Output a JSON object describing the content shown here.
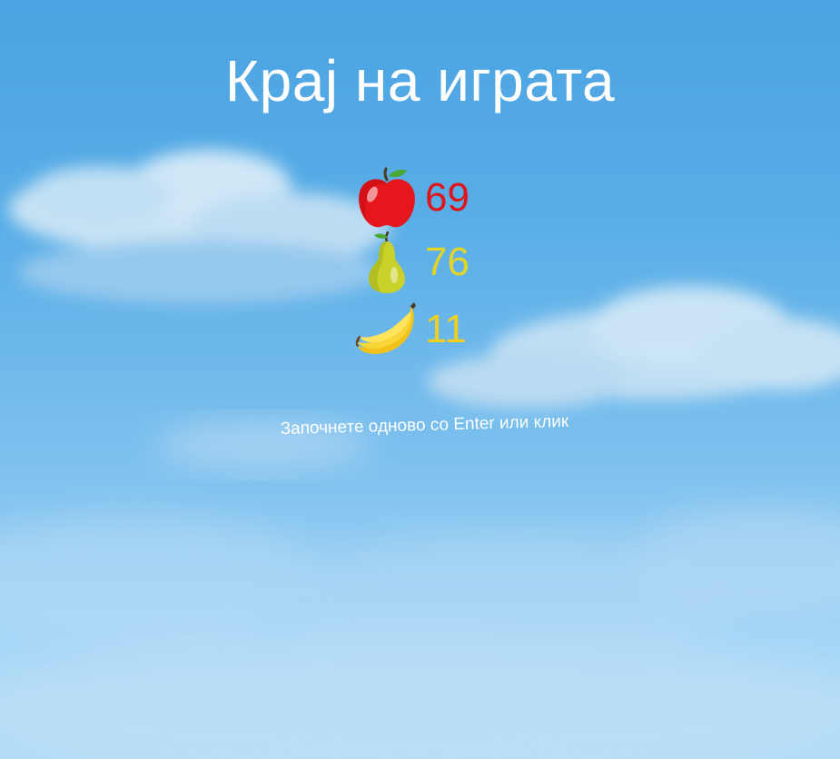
{
  "game": {
    "title": "Крај на играта",
    "restart_hint": "Започнете одново со Enter или клик"
  },
  "scores": [
    {
      "fruit": "apple-icon",
      "value": "69",
      "color": "#e0141b"
    },
    {
      "fruit": "pear-icon",
      "value": "76",
      "color": "#e4d425"
    },
    {
      "fruit": "banana-icon",
      "value": "11",
      "color": "#f2cf1e"
    }
  ]
}
